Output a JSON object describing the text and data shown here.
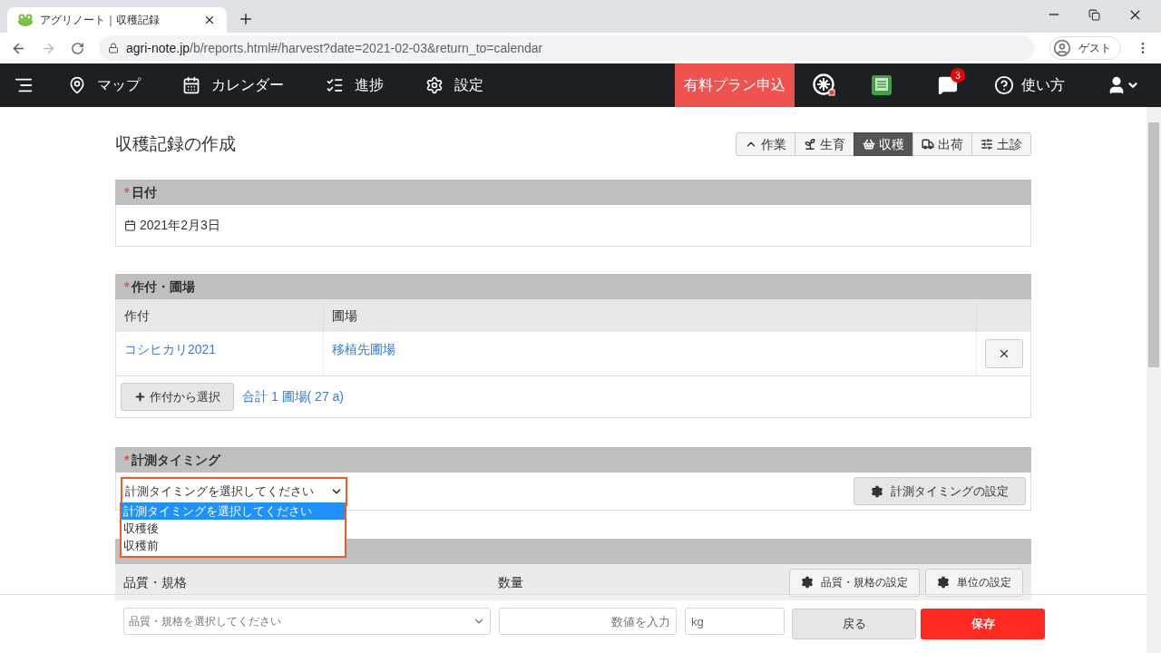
{
  "browser": {
    "tab_title": "アグリノート｜収穫記録",
    "url_host": "agri-note.jp",
    "url_path": "/b/reports.html#/harvest?date=2021-02-03&return_to=calendar",
    "profile": "ゲスト"
  },
  "nav": {
    "items": [
      {
        "kind": "map",
        "label": "マップ"
      },
      {
        "kind": "calendar",
        "label": "カレンダー"
      },
      {
        "kind": "progress",
        "label": "進捗"
      },
      {
        "kind": "settings",
        "label": "設定"
      }
    ],
    "paid_plan": "有料プラン申込",
    "notification_count": "3",
    "help": "使い方"
  },
  "page_title": "収穫記録の作成",
  "report_tabs": [
    {
      "kind": "work",
      "label": "作業",
      "selected": false
    },
    {
      "kind": "growth",
      "label": "生育",
      "selected": false
    },
    {
      "kind": "harvest",
      "label": "収穫",
      "selected": true
    },
    {
      "kind": "shipping",
      "label": "出荷",
      "selected": false
    },
    {
      "kind": "soil",
      "label": "土診",
      "selected": false
    }
  ],
  "date_section": {
    "label": "日付",
    "required_mark": "*",
    "value": "2021年2月3日"
  },
  "crop_section": {
    "label": "作付・圃場",
    "required_mark": "*",
    "columns": [
      "作付",
      "圃場"
    ],
    "rows": [
      {
        "crop": "コシヒカリ2021",
        "field": "移植先圃場"
      }
    ],
    "select_button": "作付から選択",
    "total": "合計 1 圃場( 27 a)"
  },
  "timing_section": {
    "label": "計測タイミング",
    "required_mark": "*",
    "select": {
      "value": "計測タイミングを選択してください",
      "open": true,
      "options": [
        {
          "label": "計測タイミングを選択してください",
          "selected": true
        },
        {
          "label": "収穫後",
          "selected": false
        },
        {
          "label": "収穫前",
          "selected": false
        }
      ]
    },
    "settings_button": "計測タイミングの設定"
  },
  "harvest_section": {
    "columns": [
      "品質・規格",
      "数量"
    ],
    "quality_settings_button": "品質・規格の設定",
    "unit_settings_button": "単位の設定",
    "quality_placeholder": "品質・規格を選択してください",
    "quantity_placeholder": "数値を入力",
    "unit_value": "kg"
  },
  "footer": {
    "back": "戻る",
    "save": "保存"
  }
}
